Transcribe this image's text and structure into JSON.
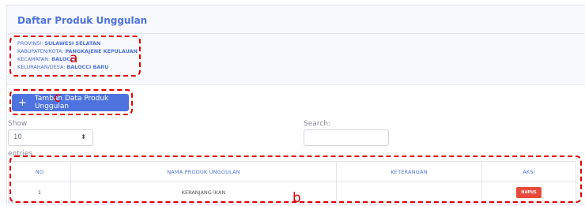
{
  "card": {
    "title": "Daftar Produk Unggulan"
  },
  "location": [
    {
      "label": "PROVINSI:",
      "value": "SULAWESI SELATAN"
    },
    {
      "label": "KABUPATEN/KOTA:",
      "value": "PANGKAJENE KEPULAUAN"
    },
    {
      "label": "KECAMATAN:",
      "value": "BALOCCI"
    },
    {
      "label": "KELURAHAN/DESA:",
      "value": "BALOCCI BARU"
    }
  ],
  "actions": {
    "add_label": "Tambah Data Produk Unggulan",
    "add_icon": "plus-icon"
  },
  "datatable": {
    "show_label": "Show",
    "entries_value": "10",
    "entries_label": "entries",
    "search_label": "Search:"
  },
  "table": {
    "headers": [
      "NO",
      "NAMA PRODUK UNGGULAN",
      "KETERANGAN",
      "AKSI"
    ],
    "rows": [
      {
        "no": "1",
        "nama": "KERANJANG IKAN",
        "keterangan": "",
        "aksi": "HAPUS"
      }
    ]
  },
  "annotations": {
    "a": "a",
    "b": "b",
    "c": "c"
  },
  "colors": {
    "primary": "#4e73df",
    "danger": "#e74a3b",
    "annotation": "#e00000"
  }
}
